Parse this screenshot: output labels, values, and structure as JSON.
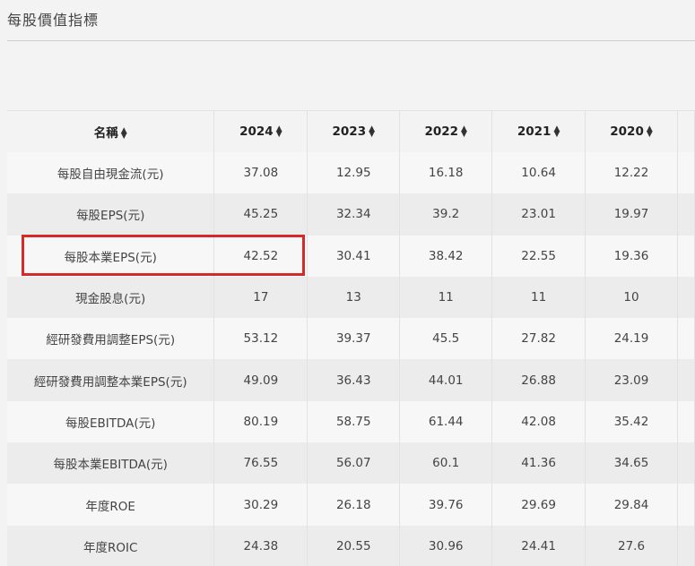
{
  "section_title": "每股價值指標",
  "table": {
    "headers": [
      "名稱",
      "2024",
      "2023",
      "2022",
      "2021",
      "2020"
    ],
    "rows": [
      [
        "每股自由現金流(元)",
        "37.08",
        "12.95",
        "16.18",
        "10.64",
        "12.22"
      ],
      [
        "每股EPS(元)",
        "45.25",
        "32.34",
        "39.2",
        "23.01",
        "19.97"
      ],
      [
        "每股本業EPS(元)",
        "42.52",
        "30.41",
        "38.42",
        "22.55",
        "19.36"
      ],
      [
        "現金股息(元)",
        "17",
        "13",
        "11",
        "11",
        "10"
      ],
      [
        "經研發費用調整EPS(元)",
        "53.12",
        "39.37",
        "45.5",
        "27.82",
        "24.19"
      ],
      [
        "經研發費用調整本業EPS(元)",
        "49.09",
        "36.43",
        "44.01",
        "26.88",
        "23.09"
      ],
      [
        "每股EBITDA(元)",
        "80.19",
        "58.75",
        "61.44",
        "42.08",
        "35.42"
      ],
      [
        "每股本業EBITDA(元)",
        "76.55",
        "56.07",
        "60.1",
        "41.36",
        "34.65"
      ],
      [
        "年度ROE",
        "30.29",
        "26.18",
        "39.76",
        "29.69",
        "29.84"
      ],
      [
        "年度ROIC",
        "24.38",
        "20.55",
        "30.96",
        "24.41",
        "27.6"
      ]
    ]
  },
  "highlight_color": "#d42a2a"
}
